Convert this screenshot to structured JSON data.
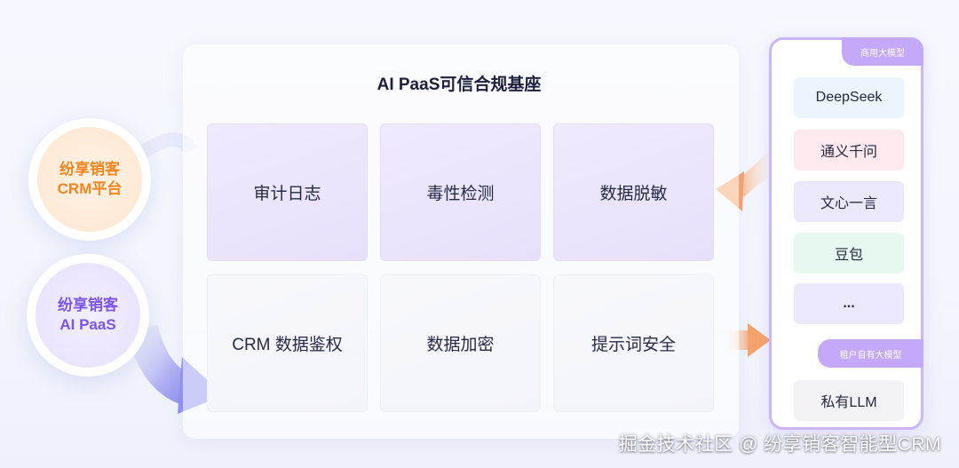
{
  "left_nodes": {
    "crm": {
      "line1": "纷享销客",
      "line2": "CRM平台"
    },
    "paas": {
      "line1": "纷享销客",
      "line2": "AI PaaS"
    }
  },
  "main": {
    "title": "AI PaaS可信合规基座",
    "cards": [
      "审计日志",
      "毒性检测",
      "数据脱敏",
      "CRM 数据鉴权",
      "数据加密",
      "提示词安全"
    ]
  },
  "right": {
    "commercial_tag": "商用大模型",
    "models": [
      "DeepSeek",
      "通义千问",
      "文心一言",
      "豆包",
      "..."
    ],
    "private_tag": "租户自有大模型",
    "private_model": "私有LLM"
  },
  "colors": {
    "crm_text": "#f6851f",
    "paas_text": "#7a55e8",
    "frame": "#c9b6fb",
    "tag": "#c4a8fa",
    "arrow_orange": "#f7a26b",
    "arrow_purple": "#8f8ff0"
  },
  "watermark": "掘金技术社区 @ 纷享销客智能型CRM"
}
